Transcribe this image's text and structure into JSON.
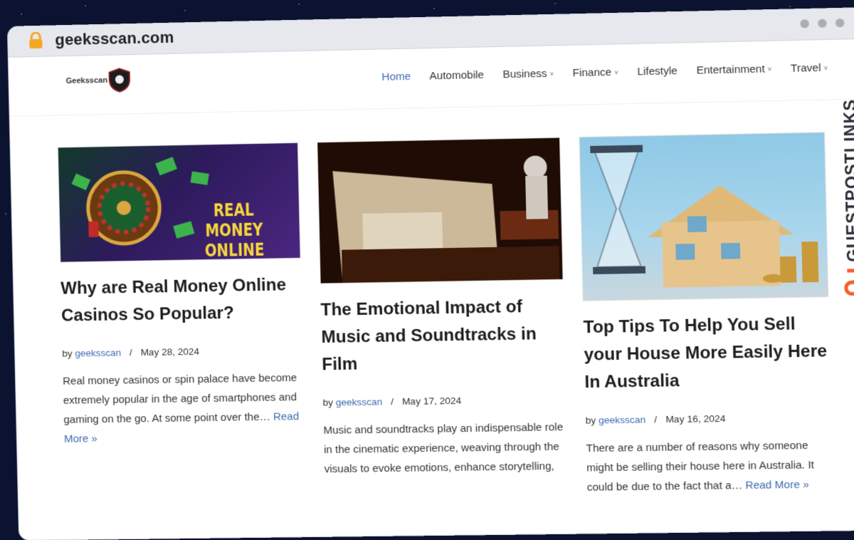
{
  "browser": {
    "url": "geeksscan.com"
  },
  "site": {
    "logo_text": "Geeksscan",
    "nav": [
      {
        "label": "Home",
        "active": true,
        "dropdown": false
      },
      {
        "label": "Automobile",
        "active": false,
        "dropdown": false
      },
      {
        "label": "Business",
        "active": false,
        "dropdown": true
      },
      {
        "label": "Finance",
        "active": false,
        "dropdown": true
      },
      {
        "label": "Lifestyle",
        "active": false,
        "dropdown": false
      },
      {
        "label": "Entertainment",
        "active": false,
        "dropdown": true
      },
      {
        "label": "Travel",
        "active": false,
        "dropdown": true
      }
    ]
  },
  "posts": [
    {
      "image_text_1": "REAL MONEY",
      "image_text_2": "ONLINE CASINOS",
      "title": "Why are Real Money Online Casinos So Popular?",
      "by": "by",
      "author": "geeksscan",
      "separator": "/",
      "date": "May 28, 2024",
      "excerpt": "Real money casinos or spin palace have become extremely popular in the age of smartphones and gaming on the go.  At some point over the…",
      "read_more": "Read More »"
    },
    {
      "title": "The Emotional Impact of Music and Soundtracks in Film",
      "by": "by",
      "author": "geeksscan",
      "separator": "/",
      "date": "May 17, 2024",
      "excerpt": "Music and soundtracks play an indispensable role in the cinematic experience, weaving through the visuals to evoke emotions, enhance storytelling,",
      "read_more": ""
    },
    {
      "title": "Top Tips To Help You Sell your House More Easily Here In Australia",
      "by": "by",
      "author": "geeksscan",
      "separator": "/",
      "date": "May 16, 2024",
      "excerpt": "There are a number of reasons why someone might be selling their house here in Australia. It could be due to the fact that a…",
      "read_more": "Read More »"
    }
  ],
  "side_brand": "GUESTPOSTLINKS",
  "colors": {
    "link": "#3d6ab0",
    "brand_orange": "#f2612d"
  }
}
